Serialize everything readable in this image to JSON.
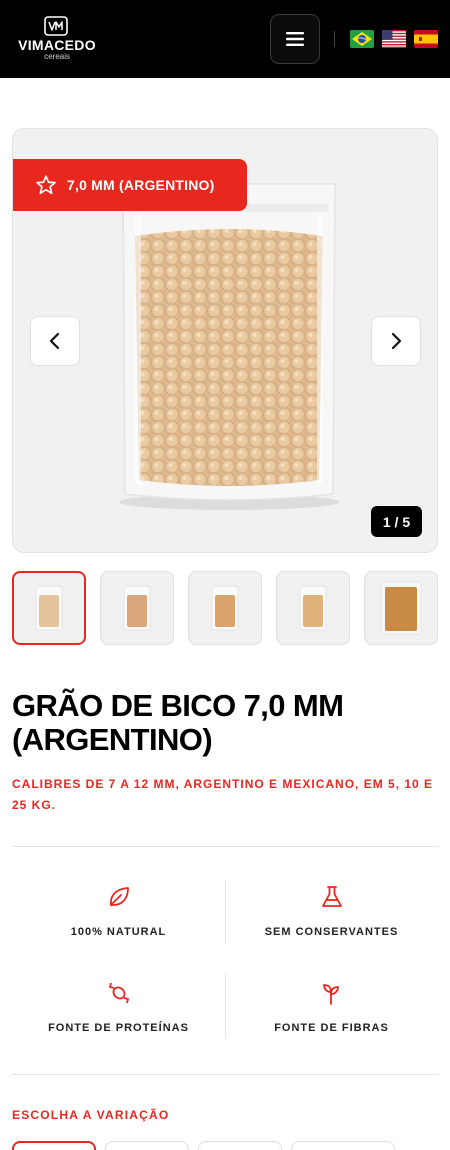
{
  "header": {
    "brand": "VIMACEDO",
    "brand_sub": "cereais",
    "flags": [
      "flag-brazil",
      "flag-usa",
      "flag-spain"
    ]
  },
  "gallery": {
    "badge_label": "7,0 MM (ARGENTINO)",
    "counter": "1 / 5",
    "thumbnails_count": 5,
    "active_thumbnail": 1
  },
  "product": {
    "title": "GRÃO DE BICO 7,0 MM (ARGENTINO)",
    "subtitle": "CALIBRES DE 7 A 12 MM, ARGENTINO E MEXICANO, EM 5, 10 E 25 KG."
  },
  "features": [
    {
      "label": "100% NATURAL",
      "icon": "leaf-icon"
    },
    {
      "label": "SEM CONSERVANTES",
      "icon": "flask-icon"
    },
    {
      "label": "FONTE DE PROTEÍNAS",
      "icon": "candy-icon"
    },
    {
      "label": "FONTE DE FIBRAS",
      "icon": "sprout-icon"
    }
  ],
  "variation": {
    "label": "ESCOLHA A VARIAÇÃO"
  },
  "colors": {
    "accent": "#e8271f",
    "header_bg": "#000000"
  }
}
